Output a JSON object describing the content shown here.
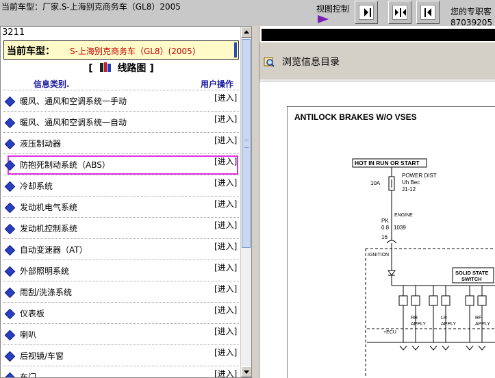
{
  "header": {
    "title": "当前车型：厂家.S-上海别克商务车（GL8）2005",
    "view_control_label": "视图控制",
    "expert_text": "您的专职客",
    "phone_text": "87039205"
  },
  "left_panel": {
    "code": "3211",
    "current_vehicle_label": "当前车型：",
    "current_vehicle_value": "S-上海别克商务车（GL8）(2005)",
    "wiring_title_open": "[",
    "wiring_title": "线路图",
    "wiring_title_close": "]",
    "col_category": "信息类别.",
    "col_action": "用户操作",
    "items": [
      {
        "label": "暖风、通风和空调系统一手动",
        "action": "[进入]"
      },
      {
        "label": "暖风、通风和空调系统一自动",
        "action": "[进入]"
      },
      {
        "label": "液压制动器",
        "action": "[进入]"
      },
      {
        "label": "防抱死制动系统（ABS）",
        "action": "[进入]"
      },
      {
        "label": "冷却系统",
        "action": "[进入]"
      },
      {
        "label": "发动机电气系统",
        "action": "[进入]"
      },
      {
        "label": "发动机控制系统",
        "action": "[进入]"
      },
      {
        "label": "自动变速器（AT）",
        "action": "[进入]"
      },
      {
        "label": "外部照明系统",
        "action": "[进入]"
      },
      {
        "label": "雨刮/洗涤系统",
        "action": "[进入]"
      },
      {
        "label": "仪表板",
        "action": "[进入]"
      },
      {
        "label": "喇叭",
        "action": "[进入]"
      },
      {
        "label": "后视镜/车窗",
        "action": "[进入]"
      },
      {
        "label": "车门",
        "action": "[进入]"
      }
    ],
    "selected_index": 3
  },
  "right_panel": {
    "browse_label": "浏览信息目录"
  },
  "diagram": {
    "title": "ANTILOCK BRAKES W/O VSES",
    "hot_label": "HOT IN RUN OR START",
    "fuse_amp": "10A",
    "power_dist_1": "POWER DIST",
    "power_dist_2": "Uh Bec",
    "power_dist_3": "J1-12",
    "engine": "ENGINE",
    "wire_color": "PK",
    "wire_gauge": "0.8",
    "circuit": "1039",
    "pin": "16",
    "ignition": "IGNITION",
    "solid_state_1": "SOLID STATE",
    "solid_state_2": "SWITCH",
    "rr_apply_1": "RR",
    "rr_apply_2": "APPLY",
    "lr_apply_1": "LR",
    "lr_apply_2": "APPLY",
    "rf_apply_1": "RF",
    "rf_apply_2": "APPLY",
    "ecu": "+ECU"
  },
  "colors": {
    "selected_outline": "#e030e0",
    "bullet": "#2a3fc0",
    "vehicle_value": "#c00000",
    "vehicle_bg": "#fffbc8"
  }
}
